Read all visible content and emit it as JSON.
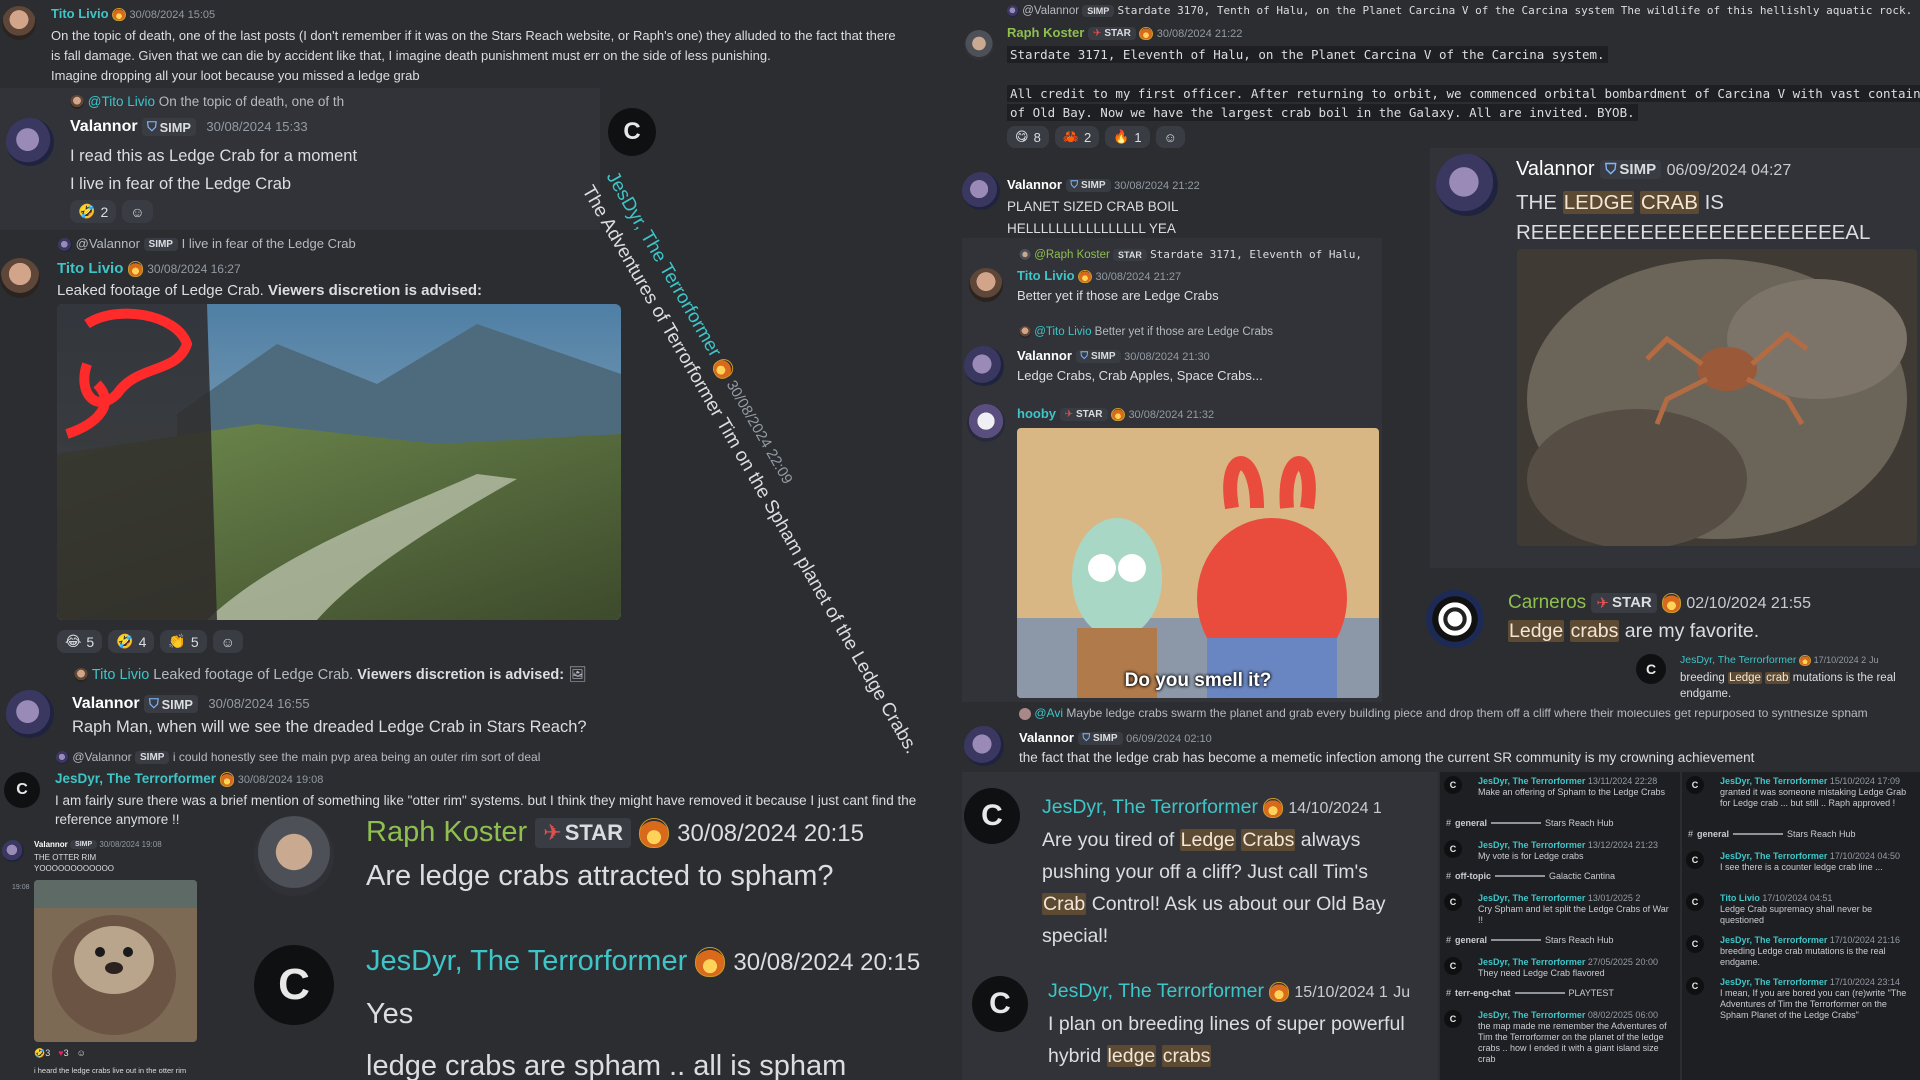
{
  "left": {
    "m1": {
      "author": "Tito Livio",
      "time": "30/08/2024 15:05",
      "lines": [
        "On the topic of death, one of the last posts (I don't remember if it was on the Stars Reach website, or Raph's one) they alluded to the fact that there",
        "is fall damage. Given that we can die by accident like that, I imagine death punishment must err on the side of less punishing.",
        "Imagine dropping all your loot because you missed a ledge grab"
      ]
    },
    "m2": {
      "reply": "@Tito Livio",
      "reply_text": "On the topic of death, one of th",
      "author": "Valannor",
      "badge": "SIMP",
      "time": "30/08/2024 15:33",
      "lines": [
        "I read this as Ledge Crab for a moment",
        "I live in fear of the Ledge Crab"
      ],
      "react_count": "2"
    },
    "m3": {
      "reply": "@Valannor",
      "reply_badge": "SIMP",
      "reply_text": "I live in fear of the Ledge Crab",
      "author": "Tito Livio",
      "time": "30/08/2024 16:27",
      "text": "Leaked footage of Ledge Crab.",
      "bold": "Viewers discretion is advised:",
      "reacts": [
        "5",
        "4",
        "5"
      ]
    },
    "m4": {
      "reply": "Tito Livio",
      "reply_text": "Leaked footage of Ledge Crab.",
      "reply_bold": "Viewers discretion is advised:",
      "author": "Valannor",
      "badge": "SIMP",
      "time": "30/08/2024 16:55",
      "text": "Raph Man, when will we see the dreaded Ledge Crab in Stars Reach?"
    },
    "m5": {
      "reply": "@Valannor",
      "reply_badge": "SIMP",
      "reply_text": "i could honestly see the main pvp area being an outer rim sort of deal",
      "author": "JesDyr, The Terrorformer",
      "time": "30/08/2024 19:08",
      "lines": [
        "I am fairly sure there was a brief mention of something like \"otter rim\" systems. but I think they might have removed it because I just cant find the",
        "reference anymore !!"
      ]
    },
    "otter": {
      "author": "Valannor",
      "badge": "SIMP",
      "time": "30/08/2024 19:08",
      "title": "THE OTTER RIM",
      "sub": "YOOOOOOOOOOOO",
      "side_time": "19:08",
      "reacts": [
        "3",
        "3"
      ],
      "footer": "i heard the ledge crabs live out in the otter rim"
    },
    "big1": {
      "author": "Raph Koster",
      "badge": "STAR",
      "time": "30/08/2024 20:15",
      "text": "Are ledge crabs attracted to spham?"
    },
    "big2": {
      "author": "JesDyr, The Terrorformer",
      "time": "30/08/2024 20:15",
      "lines": [
        "Yes",
        "ledge crabs are spham .. all is spham"
      ]
    }
  },
  "diag": {
    "author": "JesDyr, The Terrorformer",
    "time": "30/08/2024 22:09",
    "text": "The Adventures of Terrorformer Tim on the Spham planet of the Ledge Crabs."
  },
  "middle": {
    "top": {
      "reply": "@Valannor",
      "reply_badge": "SIMP",
      "reply_text": "Stardate 3170, Tenth of Halu, on the Planet Carcina V of the Carcina system  The wildlife of this hellishly aquatic rock.",
      "author": "Raph Koster",
      "badge": "STAR",
      "time": "30/08/2024 21:22",
      "code1": "Stardate 3171, Eleventh of Halu, on the Planet Carcina V of the Carcina system.",
      "code2": "All credit to my first officer. After returning to orbit, we commenced orbital bombardment of Carcina V with vast containers",
      "code3": "of Old Bay. Now we have the largest crab boil in the Galaxy. All are invited. BYOB.",
      "reacts": [
        "8",
        "2",
        "1"
      ]
    },
    "v1": {
      "author": "Valannor",
      "badge": "SIMP",
      "time": "30/08/2024 21:22",
      "lines": [
        "PLANET SIZED CRAB BOIL",
        "HELLLLLLLLLLLLLLLL YEA"
      ]
    },
    "t1": {
      "reply": "@Raph Koster",
      "reply_badge": "STAR",
      "reply_text": "Stardate 3171, Eleventh of Halu,",
      "author": "Tito Livio",
      "time": "30/08/2024 21:27",
      "text": "Better yet if those are Ledge Crabs"
    },
    "v2": {
      "reply": "@Tito Livio",
      "reply_text": "Better yet if those are Ledge Crabs",
      "author": "Valannor",
      "badge": "SIMP",
      "time": "30/08/2024 21:30",
      "text": "Ledge Crabs, Crab Apples, Space Crabs..."
    },
    "h1": {
      "author": "hooby",
      "badge": "STAR",
      "time": "30/08/2024 21:32",
      "caption": "Do you smell it?"
    },
    "v3": {
      "reply": "@Avi",
      "reply_text": "Maybe ledge crabs swarm the planet and grab every building piece and drop them off a cliff where their molecules get repurposed to synthesize spham",
      "author": "Valannor",
      "badge": "SIMP",
      "time": "06/09/2024 02:10",
      "text": "the fact that the ledge crab has become a memetic infection among the current SR community is my crowning achievement"
    },
    "j1": {
      "author": "JesDyr, The Terrorformer",
      "time": "14/10/2024 1",
      "lines": [
        "Are you tired of",
        "always",
        "pushing your off a cliff?  Just call Tim's",
        "Control! Ask us about our Old Bay",
        "special!"
      ],
      "hl": [
        "Ledge",
        "Crabs",
        "Crab"
      ]
    },
    "j2": {
      "author": "JesDyr, The Terrorformer",
      "time": "15/10/2024 1",
      "tail": "Ju",
      "line1": "I plan on breeding lines of super powerful",
      "line2": "hybrid",
      "hl": [
        "ledge",
        "crabs"
      ]
    }
  },
  "right": {
    "v4": {
      "author": "Valannor",
      "badge": "SIMP",
      "time": "06/09/2024 04:27",
      "line1a": "THE",
      "hl1": "LEDGE",
      "hl2": "CRAB",
      "line1b": "IS",
      "line2": "REEEEEEEEEEEEEEEEEEEEEEEAL"
    },
    "carn": {
      "author": "Carneros",
      "badge": "STAR",
      "time": "02/10/2024 21:55",
      "hl1": "Ledge",
      "hl2": "crabs",
      "rest": "are my favorite."
    },
    "jin": {
      "author": "JesDyr, The Terrorformer",
      "time": "17/10/2024 2",
      "tail": "Ju",
      "a": "breeding",
      "hl1": "Ledge",
      "hl2": "crab",
      "b": "mutations is the real",
      "c": "endgame."
    }
  },
  "collage": {
    "col1": [
      {
        "t": "13/11/2024 22:28",
        "text": "Make an offering of Spham to the Ledge Crabs"
      },
      {
        "chan": "general",
        "hub": "Stars Reach Hub"
      },
      {
        "t": "13/12/2024 21:23",
        "text": "My vote is for Ledge crabs"
      },
      {
        "chan": "off-topic",
        "hub": "Galactic Cantina"
      },
      {
        "t": "13/01/2025 2",
        "text": "Cry Spham and let split the Ledge Crabs of War !!"
      },
      {
        "chan": "general",
        "hub": "Stars Reach Hub"
      },
      {
        "t": "27/05/2025 20:00",
        "text": "They need Ledge Crab flavored"
      },
      {
        "chan": "terr-eng-chat",
        "hub": "PLAYTEST"
      },
      {
        "t": "08/02/2025 06:00",
        "text": "the map made me remember the Adventures of Tim the Terrorformer on the planet of the ledge crabs .. how I ended it with a giant island size crab"
      }
    ],
    "col2": [
      {
        "n": "JesDyr, The Terrorformer",
        "t": "15/10/2024 17:09",
        "text": "granted it was someone mistaking Ledge Grab for Ledge crab ... but still .. Raph approved !"
      },
      {
        "chan": "general",
        "hub": "Stars Reach Hub"
      },
      {
        "n": "JesDyr, The Terrorformer",
        "t": "17/10/2024 04:50",
        "text": "I see there is a counter ledge crab line ..."
      },
      {
        "n": "Tito Livio",
        "t": "17/10/2024 04:51",
        "text": "Ledge Crab supremacy shall never be questioned"
      },
      {
        "n": "JesDyr, The Terrorformer",
        "t": "17/10/2024 21:16",
        "text": "breeding Ledge crab mutations is the real endgame."
      },
      {
        "n": "JesDyr, The Terrorformer",
        "t": "17/10/2024 23:14",
        "text": "I mean, If you are bored you can (re)write \"The Adventures of Tim the Terrorformer on the Spham Planet of the Ledge Crabs\""
      }
    ],
    "col1_author": "JesDyr, The Terrorformer"
  },
  "colors": {
    "accent": "#3ec5c8",
    "raph": "#8fbf4f",
    "tito": "#3ec5c8",
    "hooby": "#3ec5c8",
    "carneros": "#8fbf4f",
    "valannor": "#ffffff",
    "highlight": "#5d4a33"
  }
}
